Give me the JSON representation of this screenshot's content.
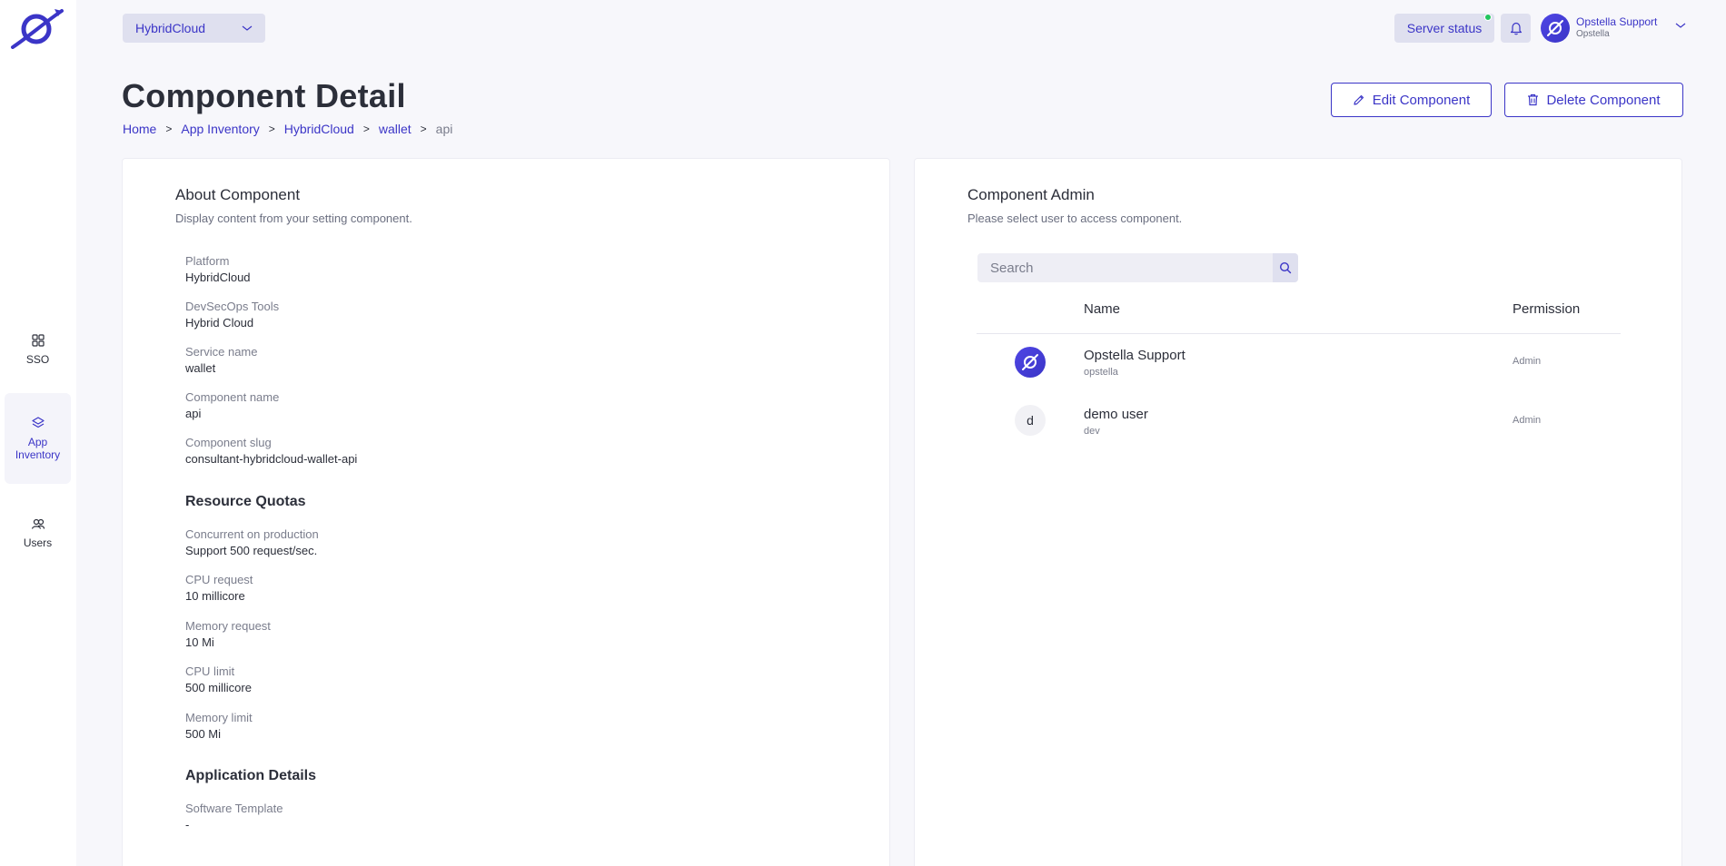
{
  "sidebar": {
    "logo": "opstella-logo",
    "items": [
      {
        "label": "SSO",
        "icon": "grid-icon",
        "active": false
      },
      {
        "label": "App Inventory",
        "icon": "layers-icon",
        "active": true
      },
      {
        "label": "Users",
        "icon": "users-icon",
        "active": false
      }
    ]
  },
  "topbar": {
    "org_select": "HybridCloud",
    "server_status": "Server status",
    "user": {
      "name": "Opstella Support",
      "org": "Opstella"
    }
  },
  "header": {
    "title": "Component Detail",
    "breadcrumb": [
      "Home",
      "App Inventory",
      "HybridCloud",
      "wallet",
      "api"
    ],
    "edit_button": "Edit Component",
    "delete_button": "Delete Component"
  },
  "about": {
    "title": "About Component",
    "subtitle": "Display content from your setting component.",
    "fields": [
      {
        "label": "Platform",
        "value": "HybridCloud"
      },
      {
        "label": "DevSecOps Tools",
        "value": "Hybrid Cloud"
      },
      {
        "label": "Service name",
        "value": "wallet"
      },
      {
        "label": "Component name",
        "value": "api"
      },
      {
        "label": "Component slug",
        "value": "consultant-hybridcloud-wallet-api"
      }
    ],
    "resource_quotas": {
      "title": "Resource Quotas",
      "fields": [
        {
          "label": "Concurrent on production",
          "value": "Support 500 request/sec."
        },
        {
          "label": "CPU request",
          "value": "10 millicore"
        },
        {
          "label": "Memory request",
          "value": "10 Mi"
        },
        {
          "label": "CPU limit",
          "value": "500 millicore"
        },
        {
          "label": "Memory limit",
          "value": "500 Mi"
        }
      ]
    },
    "application_details": {
      "title": "Application Details",
      "fields": [
        {
          "label": "Software Template",
          "value": "-"
        }
      ]
    }
  },
  "admin": {
    "title": "Component Admin",
    "subtitle": "Please select user to access component.",
    "search_placeholder": "Search",
    "columns": {
      "name": "Name",
      "permission": "Permission"
    },
    "rows": [
      {
        "avatar": "opstella-logo",
        "name": "Opstella Support",
        "username": "opstella",
        "permission": "Admin"
      },
      {
        "avatar": "d",
        "name": "demo user",
        "username": "dev",
        "permission": "Admin"
      }
    ]
  },
  "colors": {
    "accent": "#3b35c7",
    "background": "#f7f7fb",
    "chip": "#dfe0ef",
    "status_online": "#22c55e"
  }
}
